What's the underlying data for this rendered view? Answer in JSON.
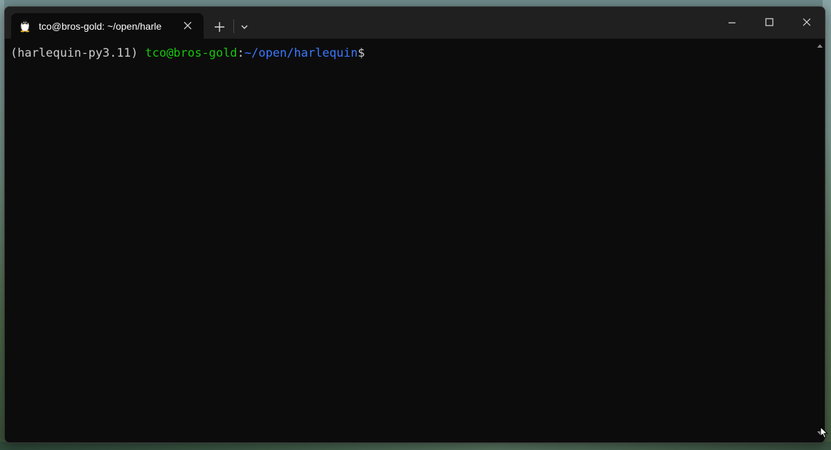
{
  "window": {
    "tab": {
      "title": "tco@bros-gold: ~/open/harle",
      "icon": "linux-penguin-icon",
      "close_icon": "close-icon"
    },
    "new_tab_icon": "plus-icon",
    "dropdown_icon": "chevron-down-icon",
    "controls": {
      "minimize_icon": "minimize-icon",
      "maximize_icon": "maximize-icon",
      "close_icon": "close-icon"
    }
  },
  "terminal": {
    "prompt": {
      "env": "(harlequin-py3.11)",
      "user_host": "tco@bros-gold",
      "separator": ":",
      "path": "~/open/harlequin",
      "symbol": "$"
    }
  },
  "colors": {
    "background": "#0c0c0c",
    "titlebar": "#202020",
    "text": "#cccccc",
    "user_host": "#16c60c",
    "path": "#3b78ff"
  }
}
